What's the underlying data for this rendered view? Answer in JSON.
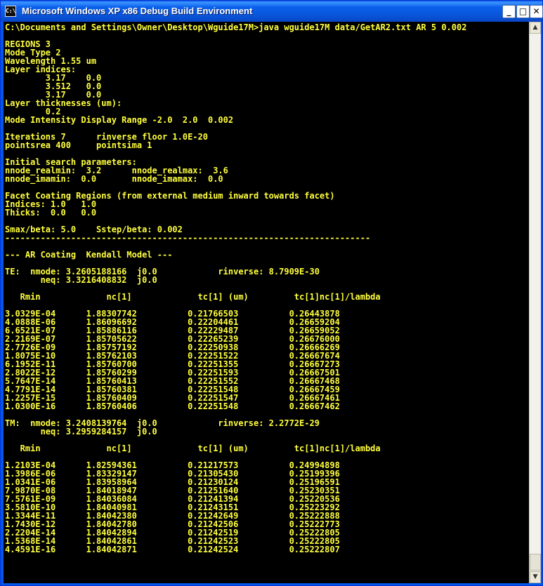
{
  "window": {
    "title": "Microsoft Windows XP x86 Debug Build Environment",
    "icon_text": "C:\\",
    "buttons": {
      "minimize": "_",
      "maximize": "□",
      "close": "✕"
    }
  },
  "scrollbar": {
    "up": "▲",
    "down": "▼"
  },
  "console": {
    "lines": [
      "C:\\Documents and Settings\\Owner\\Desktop\\Wguide17M>java wguide17M data/GetAR2.txt AR 5 0.002",
      "",
      "REGIONS 3",
      "Mode Type 2",
      "Wavelength 1.55 um",
      "Layer indices:",
      "        3.17    0.0",
      "        3.512   0.0",
      "        3.17    0.0",
      "Layer thicknesses (um):",
      "        0.2",
      "Mode Intensity Display Range -2.0  2.0  0.002",
      "",
      "Iterations 7      rinverse floor 1.0E-20",
      "pointsrea 400     pointsima 1",
      "",
      "Initial search parameters:",
      "nnode_realmin:  3.2      nnode_realmax:  3.6",
      "nnode_imamin:  0.0       nnode_imamax:  0.0",
      "",
      "Facet Coating Regions (from external medium inward towards facet)",
      "Indices: 1.0   1.0",
      "Thicks:  0.0   0.0",
      "",
      "Smax/beta: 5.0    Sstep/beta: 0.002",
      "------------------------------------------------------------------------",
      "",
      "--- AR Coating  Kendall Model ---",
      "",
      "TE:  nmode: 3.2605188166  j0.0            rinverse: 8.7909E-30",
      "       neq: 3.3216408832  j0.0",
      "",
      "   Rmin             nc[1]             tc[1] (um)         tc[1]nc[1]/lambda",
      "",
      "3.0329E-04      1.88307742          0.21766503          0.26443878",
      "4.0888E-06      1.86096692          0.22204461          0.26659204",
      "6.6521E-07      1.85886116          0.22229487          0.26659052",
      "2.2169E-07      1.85705622          0.22265239          0.26676000",
      "2.7726E-09      1.85757192          0.22250938          0.26666269",
      "1.8075E-10      1.85762103          0.22251522          0.26667674",
      "6.1952E-11      1.85760700          0.22251355          0.26667273",
      "2.8022E-12      1.85760299          0.22251593          0.26667501",
      "5.7647E-14      1.85760413          0.22251552          0.26667468",
      "4.7791E-14      1.85760381          0.22251548          0.26667459",
      "1.2257E-15      1.85760409          0.22251547          0.26667461",
      "1.0300E-16      1.85760406          0.22251548          0.26667462",
      "",
      "TM:  nmode: 3.2408139764  j0.0            rinverse: 2.2772E-29",
      "       neq: 3.2959284157  j0.0",
      "",
      "   Rmin             nc[1]             tc[1] (um)         tc[1]nc[1]/lambda",
      "",
      "1.2103E-04      1.82594361          0.21217573          0.24994898",
      "1.3986E-06      1.83329147          0.21305430          0.25199396",
      "1.0341E-06      1.83958964          0.21230124          0.25196591",
      "7.9870E-08      1.84018947          0.21251640          0.25230351",
      "7.5761E-09      1.84036084          0.21241394          0.25220536",
      "3.5810E-10      1.84040981          0.21243151          0.25223292",
      "1.3344E-11      1.84042380          0.21242649          0.25222888",
      "1.7430E-12      1.84042780          0.21242506          0.25222773",
      "2.2204E-14      1.84042894          0.21242519          0.25222805",
      "1.5368E-14      1.84042861          0.21242523          0.25222805",
      "4.4591E-16      1.84042871          0.21242524          0.25222807"
    ]
  }
}
